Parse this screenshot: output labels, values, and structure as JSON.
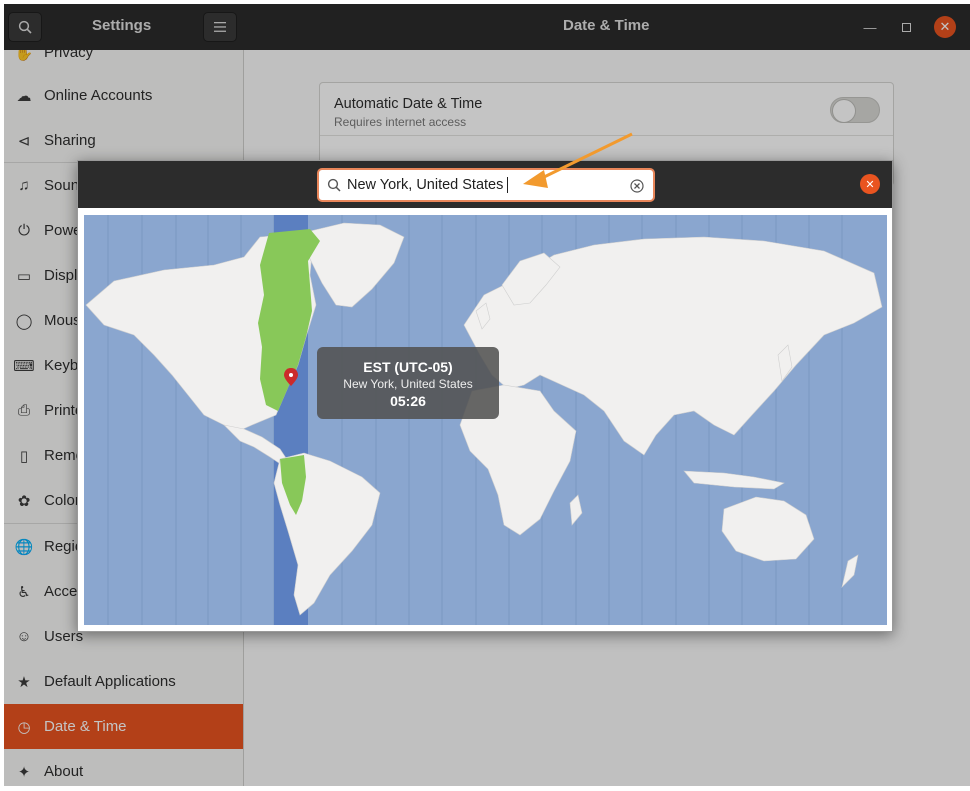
{
  "header": {
    "sidebar_title": "Settings",
    "page_title": "Date & Time"
  },
  "sidebar": {
    "items": [
      {
        "label": "Privacy",
        "icon": "hand-icon"
      },
      {
        "label": "Online Accounts",
        "icon": "cloud-icon"
      },
      {
        "label": "Sharing",
        "icon": "share-icon"
      },
      {
        "label": "Sound",
        "icon": "music-note-icon"
      },
      {
        "label": "Power",
        "icon": "power-icon"
      },
      {
        "label": "Displays",
        "icon": "display-icon"
      },
      {
        "label": "Mouse & Touchpad",
        "icon": "mouse-icon"
      },
      {
        "label": "Keyboard Shortcuts",
        "icon": "keyboard-icon"
      },
      {
        "label": "Printers",
        "icon": "printer-icon"
      },
      {
        "label": "Removable Media",
        "icon": "removable-media-icon"
      },
      {
        "label": "Color",
        "icon": "color-icon"
      },
      {
        "label": "Region & Language",
        "icon": "globe-icon"
      },
      {
        "label": "Accessibility",
        "icon": "accessibility-icon"
      },
      {
        "label": "Users",
        "icon": "users-icon"
      },
      {
        "label": "Default Applications",
        "icon": "star-icon"
      },
      {
        "label": "Date & Time",
        "icon": "clock-icon",
        "active": true
      },
      {
        "label": "About",
        "icon": "sparkle-icon"
      }
    ]
  },
  "content": {
    "auto_datetime_label": "Automatic Date & Time",
    "auto_datetime_sub": "Requires internet access",
    "auto_datetime_enabled": false
  },
  "dialog": {
    "search_value": "New York, United States",
    "tooltip": {
      "abbr": "EST (UTC-05)",
      "city": "New York, United States",
      "time": "05:26"
    }
  },
  "colors": {
    "accent": "#e95420",
    "headerbar": "#2c2c2c",
    "ocean": "#8aa6cf",
    "land": "#f1f0ef",
    "selected_zone": "#88c859"
  }
}
